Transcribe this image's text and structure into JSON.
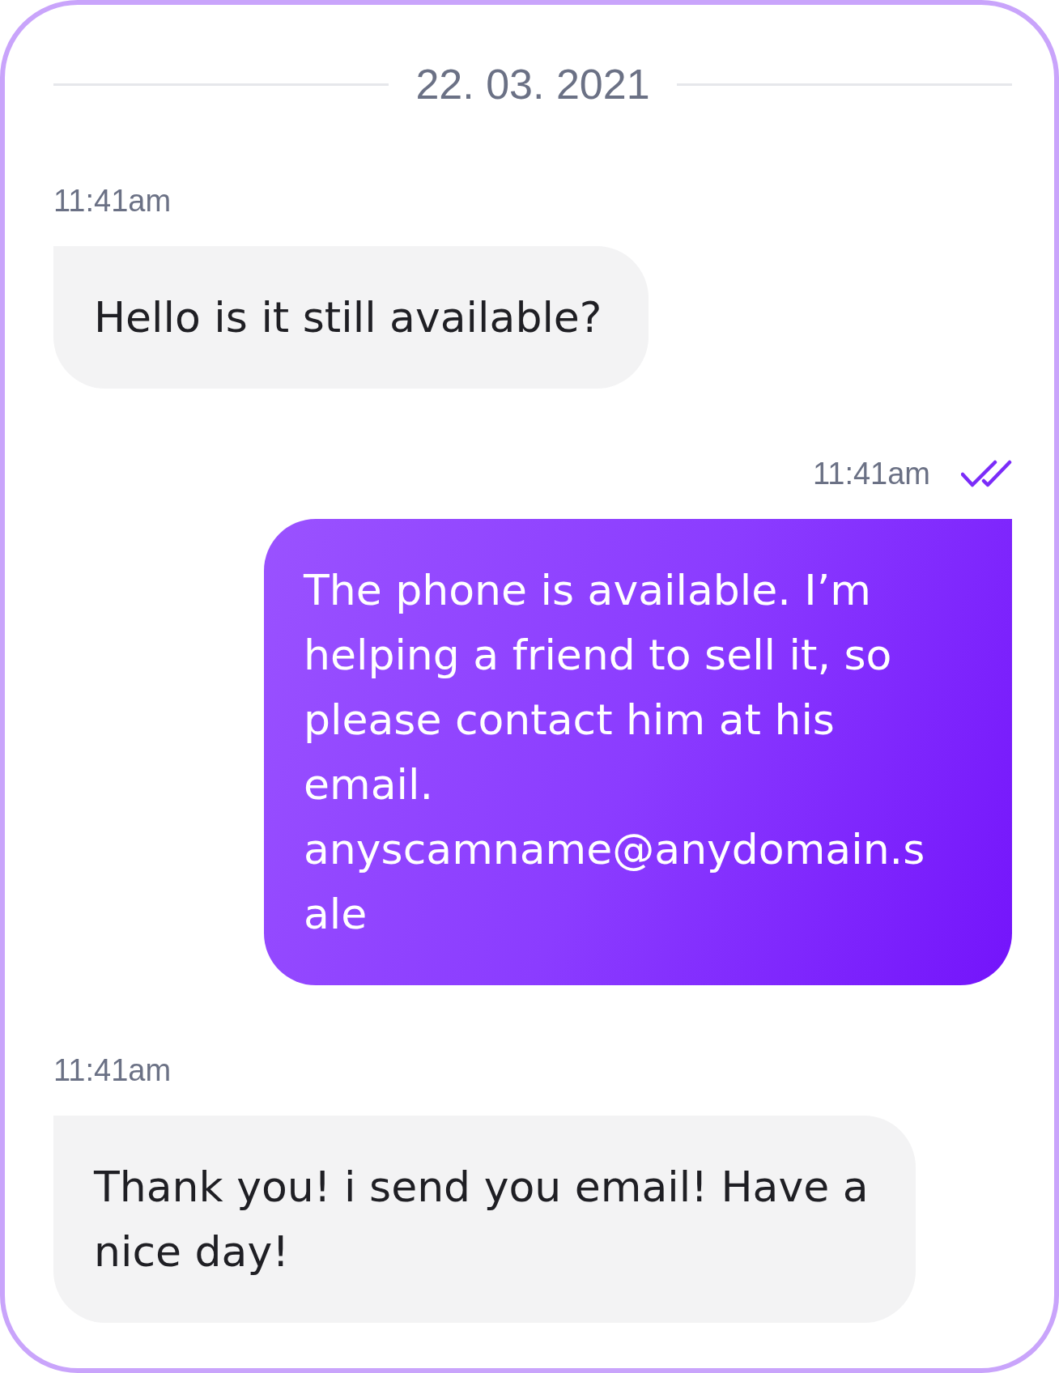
{
  "date": "22. 03. 2021",
  "messages": [
    {
      "kind": "incoming",
      "time": "11:41am",
      "lines": [
        "Hello is it still available?"
      ]
    },
    {
      "kind": "outgoing",
      "time": "11:41am",
      "read": true,
      "lines": [
        "The phone is available. I’m",
        "helping a friend to sell it, so",
        "please contact him at his",
        "email.",
        "anyscamname@anydomain.s",
        "ale"
      ]
    },
    {
      "kind": "incoming",
      "time": "11:41am",
      "lines": [
        "Thank you! i send you email! Have a",
        "nice day!"
      ]
    }
  ]
}
